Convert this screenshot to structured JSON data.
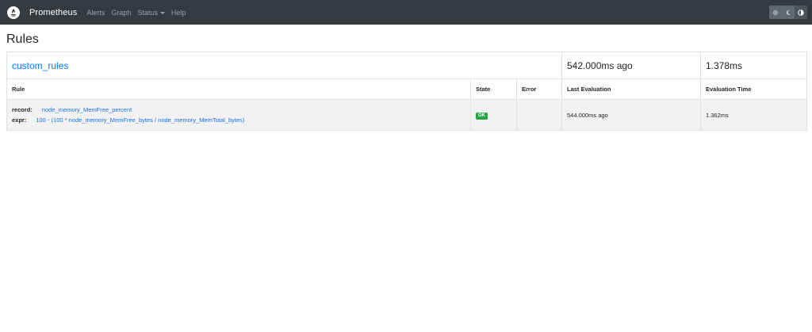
{
  "navbar": {
    "brand": "Prometheus",
    "links": [
      {
        "label": "Alerts"
      },
      {
        "label": "Graph"
      },
      {
        "label": "Status"
      },
      {
        "label": "Help"
      }
    ],
    "theme_buttons": [
      "sun-icon",
      "moon-icon",
      "contrast-icon"
    ]
  },
  "page_title": "Rules",
  "group": {
    "name": "custom_rules",
    "last_evaluation": "542.000ms ago",
    "evaluation_time": "1.378ms"
  },
  "columns": [
    "Rule",
    "State",
    "Error",
    "Last Evaluation",
    "Evaluation Time"
  ],
  "rules": [
    {
      "record_key": "record:",
      "record_value": "node_memory_MemFree_percent",
      "expr_key": "expr:",
      "expr_value": "100 - (100 * node_memory_MemFree_bytes / node_memory_MemTotal_bytes)",
      "state": "OK",
      "error": "",
      "last_evaluation": "544.000ms ago",
      "evaluation_time": "1.362ms"
    }
  ],
  "colors": {
    "navbar_bg": "#343a40",
    "link_blue": "#007bff",
    "ok_green": "#28a745",
    "row_bg": "#f2f2f2"
  }
}
